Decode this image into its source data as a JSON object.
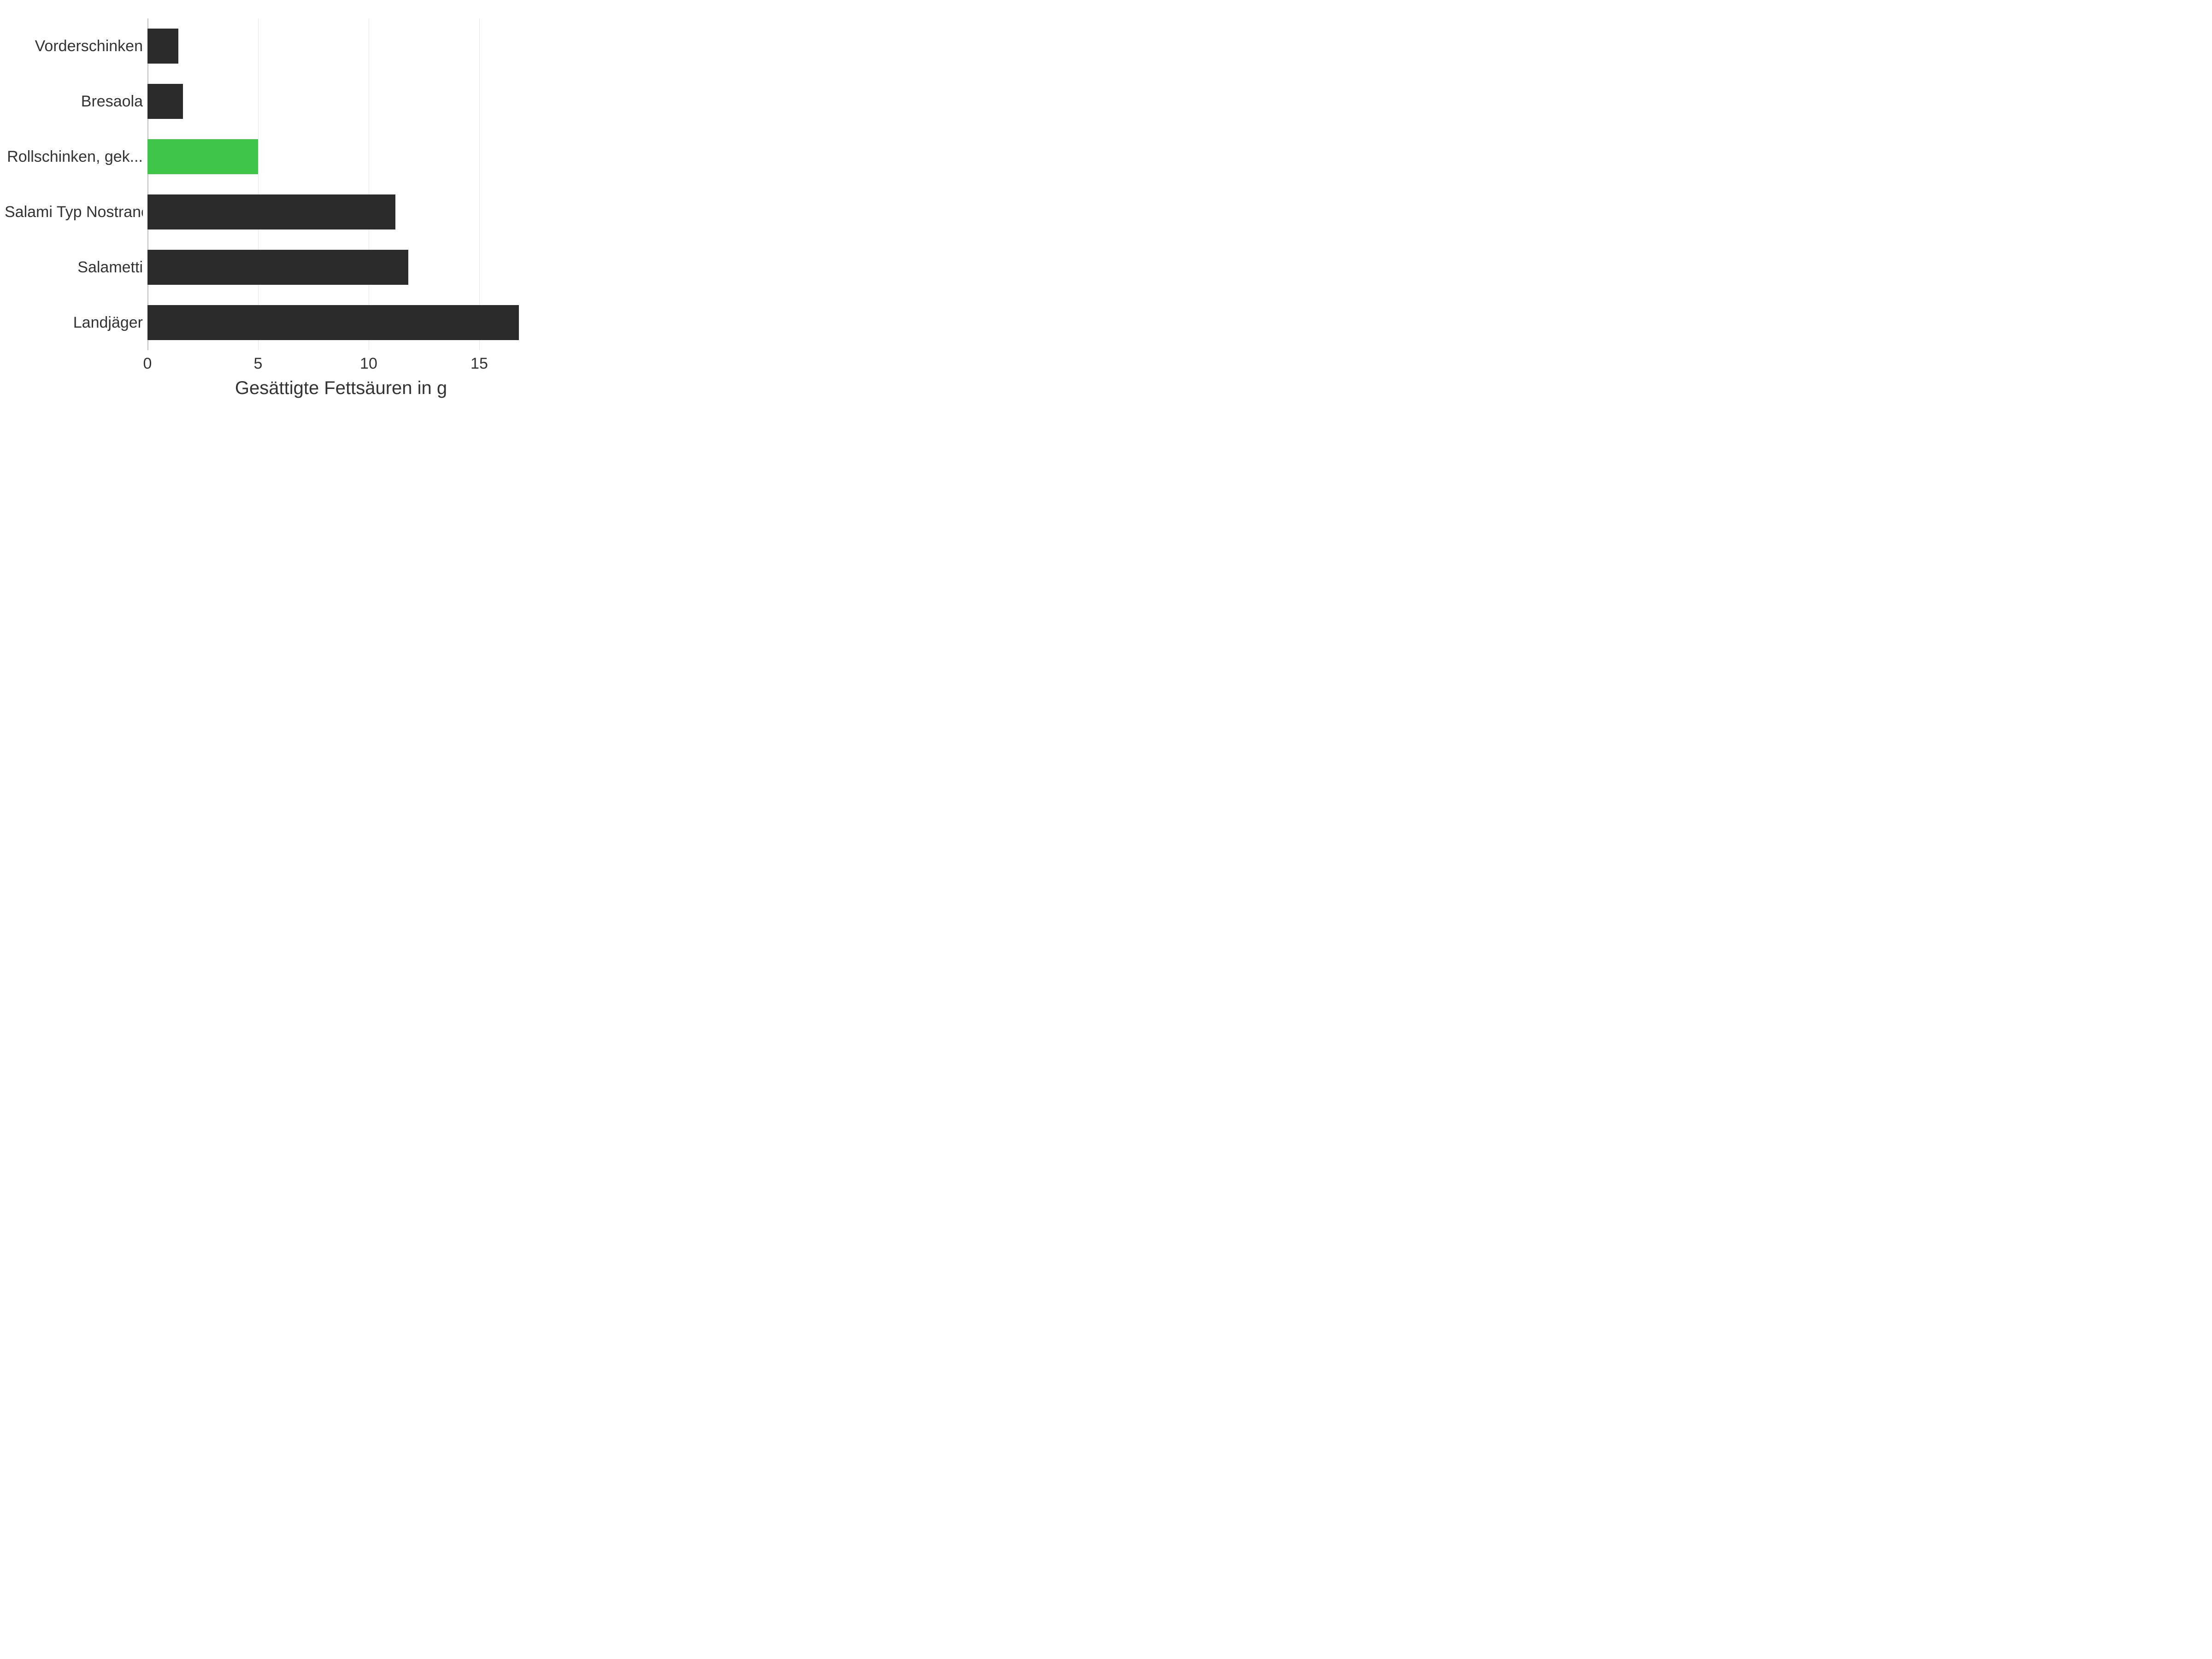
{
  "chart_data": {
    "type": "bar",
    "orientation": "horizontal",
    "categories": [
      "Vorderschinken",
      "Bresaola",
      "Rollschinken, gek...",
      "Salami Typ Nostrano",
      "Salametti",
      "Landjäger"
    ],
    "values": [
      1.4,
      1.6,
      5.0,
      11.2,
      11.8,
      16.8
    ],
    "highlight_index": 2,
    "xlabel": "Gesättigte Fettsäuren in g",
    "ylabel": "",
    "xlim": [
      0,
      17.5
    ],
    "xticks": [
      0,
      5,
      10,
      15
    ],
    "colors": {
      "default": "#2b2b2b",
      "highlight": "#3ec54a"
    }
  }
}
